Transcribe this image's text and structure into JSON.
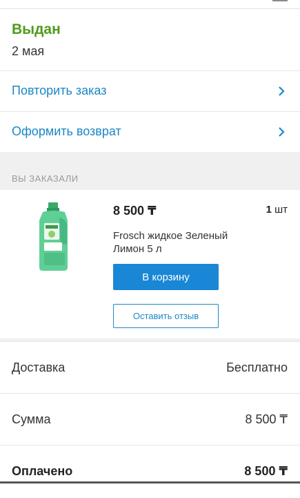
{
  "order": {
    "status": "Выдан",
    "date": "2 мая"
  },
  "actions": {
    "repeat_label": "Повторить заказ",
    "return_label": "Оформить возврат"
  },
  "ordered": {
    "section_title": "ВЫ ЗАКАЗАЛИ",
    "items": [
      {
        "price": "8 500 ₸",
        "qty": "1",
        "qty_unit": "шт",
        "name": "Frosch жидкое Зеленый Лимон 5 л",
        "cart_button": "В корзину",
        "review_button": "Оставить отзыв"
      }
    ]
  },
  "summary": {
    "delivery_label": "Доставка",
    "delivery_value": "Бесплатно",
    "sum_label": "Сумма",
    "sum_value": "8 500 ₸",
    "paid_label": "Оплачено",
    "paid_value": "8 500 ₸"
  },
  "colors": {
    "status_green": "#4f9a1a",
    "link_blue": "#1a87c5",
    "button_blue": "#1a87d6"
  }
}
